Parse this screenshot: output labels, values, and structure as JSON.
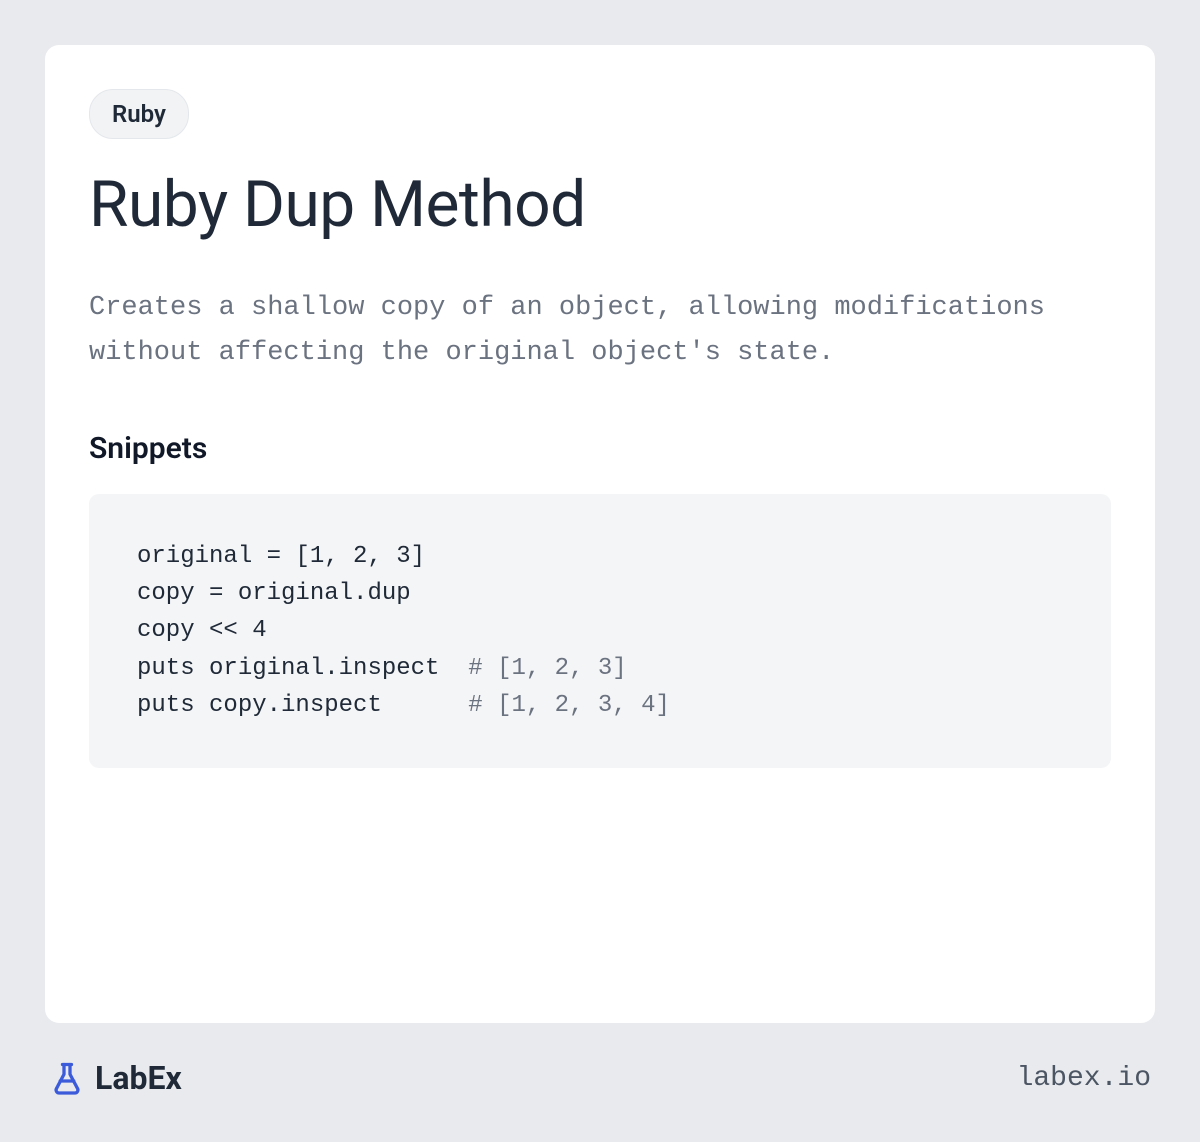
{
  "badge": "Ruby",
  "title": "Ruby Dup Method",
  "description": "Creates a shallow copy of an object, allowing modifications without affecting the original object's state.",
  "snippets": {
    "heading": "Snippets",
    "code": {
      "line1": "original = [1, 2, 3]",
      "line2": "copy = original.dup",
      "line3": "copy << 4",
      "line4_code": "puts original.inspect  ",
      "line4_comment": "# [1, 2, 3]",
      "line5_code": "puts copy.inspect      ",
      "line5_comment": "# [1, 2, 3, 4]"
    }
  },
  "footer": {
    "brand": "LabEx",
    "url": "labex.io"
  }
}
